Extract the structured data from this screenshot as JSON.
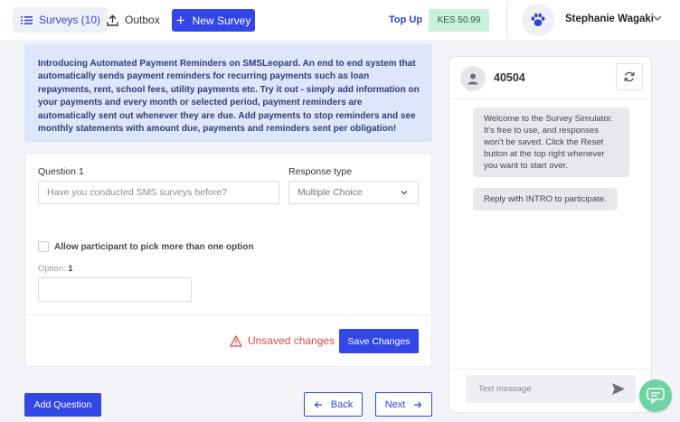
{
  "topbar": {
    "surveys_tab_label": "Surveys (10)",
    "outbox_tab_label": "Outbox",
    "new_survey_label": "New Survey",
    "topup_label": "Top Up",
    "balance": "KES 50.99",
    "user_name": "Stephanie Wagaki"
  },
  "banner": {
    "text": "Introducing Automated Payment Reminders on SMSLeopard. An end to end system that automatically sends payment reminders for recurring payments such as loan repayments, rent, school fees, utility payments etc. Try it out - simply add information on your payments and every month or selected period, payment reminders are automatically sent out whenever they are due. Add payments to stop reminders and see monthly statements with amount due, payments and reminders sent per obligation!"
  },
  "question": {
    "label": "Question 1",
    "placeholder": "Have you conducted SMS surveys before?",
    "response_type_label": "Response type",
    "response_type_value": "Multiple Choice",
    "multi_select_label": "Allow participant to pick more than one option",
    "option_label": "Option:",
    "option_number": "1",
    "unsaved_label": "Unsaved changes",
    "save_label": "Save Changes"
  },
  "footer": {
    "add_question_label": "Add Question",
    "back_label": "Back",
    "next_label": "Next"
  },
  "simulator": {
    "number": "40504",
    "messages": [
      "Welcome to the Survey Simulator. It's free to use, and responses won't be saved. Click the Reset button at the top right whenever you want to start over.",
      "Reply with INTRO to participate."
    ],
    "input_placeholder": "Text message"
  },
  "colors": {
    "accent": "#3346e6",
    "balance_bg": "#c8f1dc",
    "banner_bg": "#dde6fb",
    "warning": "#e04a4a",
    "chat_fab": "#6dd3a2"
  },
  "icons": [
    "list-icon",
    "upload-icon",
    "plus-icon",
    "paw-icon",
    "chevron-down-icon",
    "user-icon",
    "refresh-icon",
    "warning-icon",
    "arrow-left-icon",
    "arrow-right-icon",
    "send-icon",
    "chat-icon"
  ]
}
